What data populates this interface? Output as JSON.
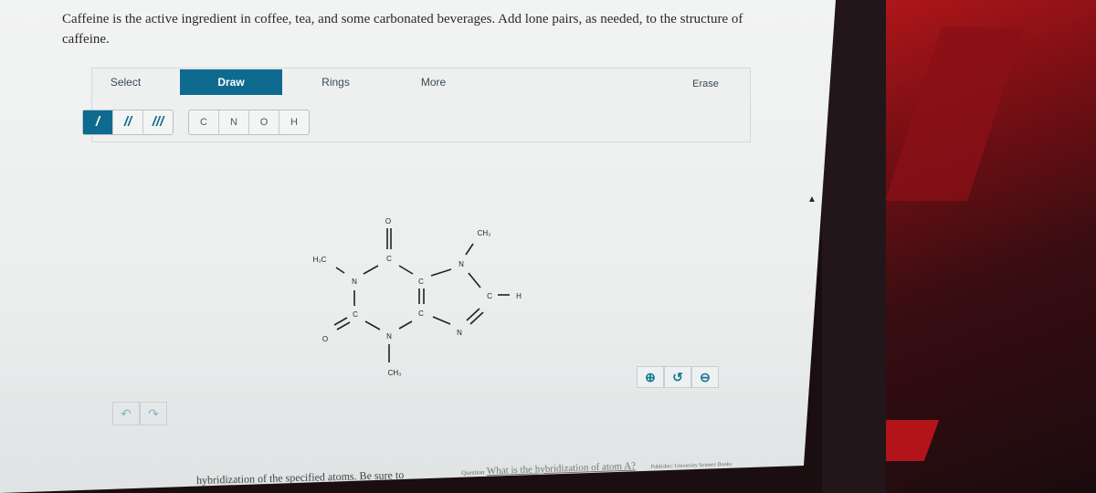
{
  "question": {
    "text": "Caffeine is the active ingredient in coffee, tea, and some carbonated beverages. Add lone pairs, as needed, to the structure of caffeine."
  },
  "toolbar": {
    "tabs": [
      {
        "label": "Select",
        "active": false
      },
      {
        "label": "Draw",
        "active": true
      },
      {
        "label": "Rings",
        "active": false
      },
      {
        "label": "More",
        "active": false
      },
      {
        "label": "Erase",
        "active": false
      }
    ],
    "bond_tools": [
      {
        "label": "/",
        "name": "single-bond",
        "selected": true
      },
      {
        "label": "//",
        "name": "double-bond",
        "selected": false
      },
      {
        "label": "///",
        "name": "triple-bond",
        "selected": false
      }
    ],
    "atom_tools": [
      "C",
      "N",
      "O",
      "H"
    ]
  },
  "molecule": {
    "name": "caffeine",
    "atoms": {
      "O_top": "O",
      "C_carbonyl_top": "C",
      "H3C_left": "H₃C",
      "N1": "N",
      "C2": "C",
      "O_left": "O",
      "N3": "N",
      "CH3_bottom": "CH₃",
      "C4": "C",
      "C5": "C",
      "N7": "N",
      "CH3_top": "CH₃",
      "C8": "C",
      "H8": "H",
      "N9": "N"
    }
  },
  "canvas_controls": {
    "zoom_in": "zoom-in-icon",
    "reset": "reset-zoom-icon",
    "zoom_out": "zoom-out-icon",
    "undo": "undo-icon",
    "redo": "redo-icon"
  },
  "footer": {
    "partial_instruction": "hybridization of the specified atoms. Be sure to",
    "next_question": "What is the hybridization of atom A?",
    "meta_left": "Question",
    "meta_right": "Publisher: University Science Books"
  },
  "colors": {
    "accent": "#0e6a8f",
    "icon_teal": "#0e7c8f"
  }
}
